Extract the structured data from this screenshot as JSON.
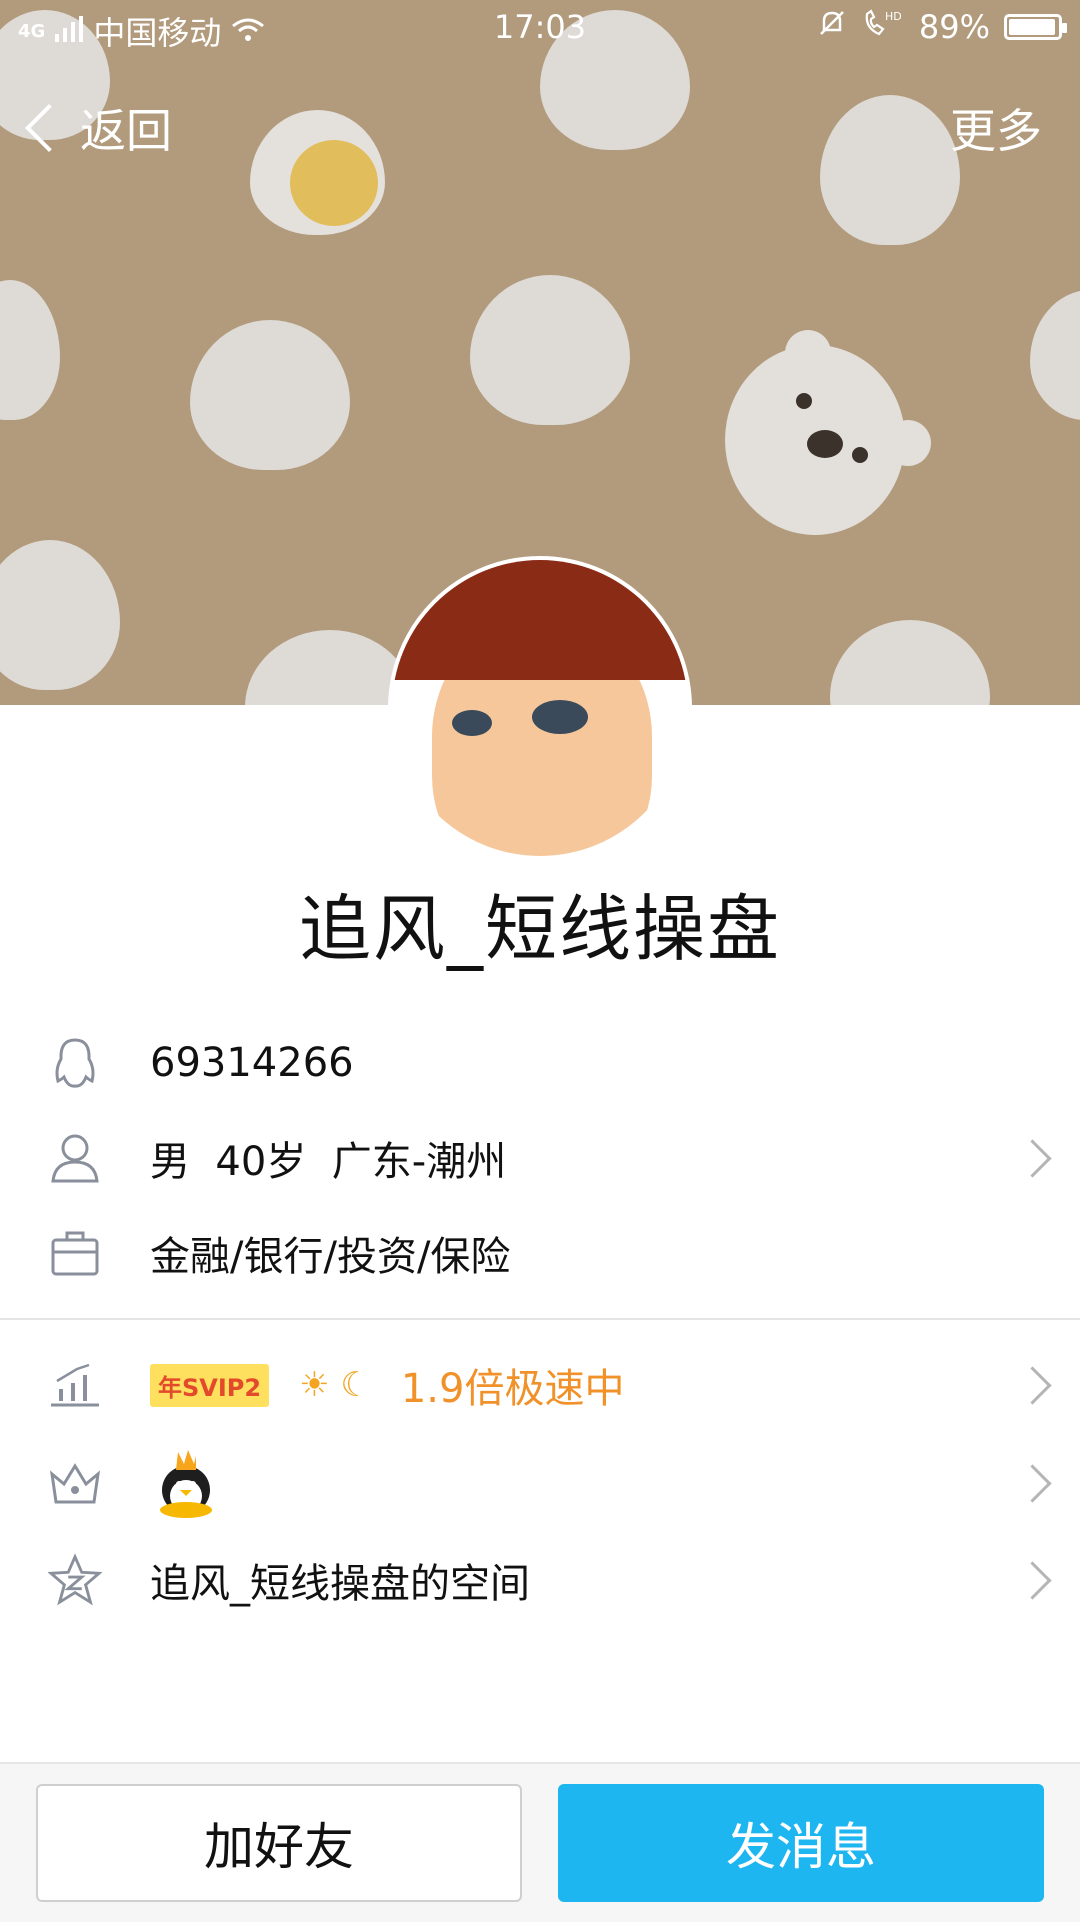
{
  "status_bar": {
    "network": "4G",
    "carrier": "中国移动",
    "time": "17:03",
    "battery": "89%"
  },
  "nav": {
    "back_label": "返回",
    "more_label": "更多"
  },
  "profile": {
    "name": "追风_短线操盘",
    "qq_number": "69314266",
    "basic_info": "男  40岁  广东-潮州",
    "occupation": "金融/银行/投资/保险"
  },
  "vip": {
    "badge": "年SVIP2",
    "level_icons": "☀ ☾",
    "speed_text": "1.9倍极速中"
  },
  "space": {
    "label": "追风_短线操盘的空间"
  },
  "buttons": {
    "add_friend": "加好友",
    "send_message": "发消息"
  },
  "colors": {
    "header_bg": "#b19b7c",
    "accent": "#1eb6f1",
    "speed": "#f19129"
  }
}
